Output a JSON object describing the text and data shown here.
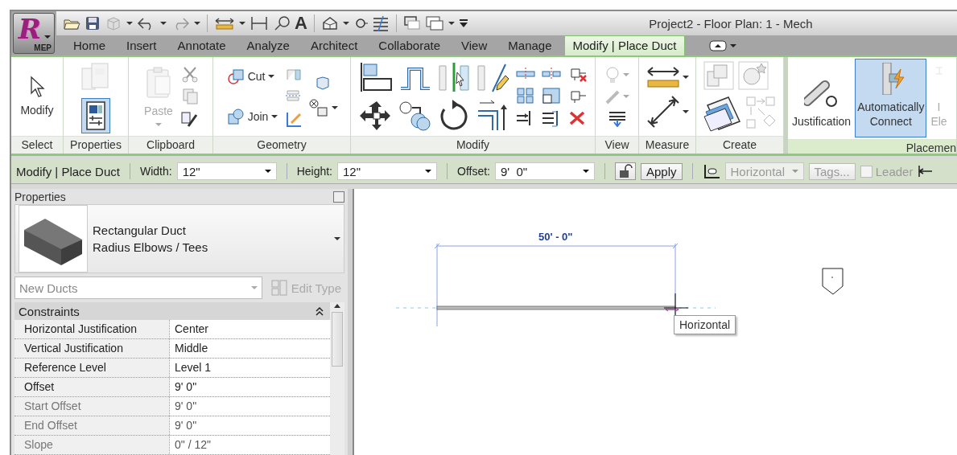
{
  "app_button": {
    "logo_letter": "R",
    "label": "MEP"
  },
  "quick_access": {
    "text_tool": "A"
  },
  "window": {
    "title": "Project2 - Floor Plan: 1 - Mech"
  },
  "tabs": [
    {
      "label": "Home",
      "selected": false
    },
    {
      "label": "Insert",
      "selected": false
    },
    {
      "label": "Annotate",
      "selected": false
    },
    {
      "label": "Analyze",
      "selected": false
    },
    {
      "label": "Architect",
      "selected": false
    },
    {
      "label": "Collaborate",
      "selected": false
    },
    {
      "label": "View",
      "selected": false
    },
    {
      "label": "Manage",
      "selected": false
    },
    {
      "label": "Modify | Place Duct",
      "selected": true
    }
  ],
  "ribbon": {
    "panels": [
      {
        "label": "Select",
        "contextual": false,
        "tools": [
          {
            "kind": "large",
            "label": "Modify",
            "selected": false,
            "disabled": false
          }
        ]
      },
      {
        "label": "Properties",
        "contextual": false,
        "tools": [
          {
            "kind": "stack",
            "selected": false,
            "disabled": true
          },
          {
            "kind": "stack",
            "selected": true,
            "disabled": false
          }
        ]
      },
      {
        "label": "Clipboard",
        "contextual": false,
        "tools": [
          {
            "kind": "large",
            "label": "Paste",
            "selected": false,
            "disabled": true
          }
        ]
      },
      {
        "label": "Geometry",
        "contextual": false,
        "tools": [
          {
            "kind": "small",
            "label": "Cut",
            "selected": false,
            "disabled": false
          },
          {
            "kind": "small",
            "label": "Join",
            "selected": false,
            "disabled": false
          }
        ]
      },
      {
        "label": "Modify",
        "contextual": false
      },
      {
        "label": "View",
        "contextual": false
      },
      {
        "label": "Measure",
        "contextual": false
      },
      {
        "label": "Create",
        "contextual": false
      },
      {
        "label": "Placemen",
        "contextual": true,
        "tools": [
          {
            "kind": "large",
            "label": "Justification",
            "selected": false,
            "disabled": false
          },
          {
            "kind": "large",
            "label": "Automatically\nConnect",
            "selected": true,
            "disabled": false
          },
          {
            "kind": "large",
            "label": "I\nEle",
            "selected": false,
            "disabled": true
          }
        ]
      }
    ]
  },
  "options_bar": {
    "context": "Modify | Place Duct",
    "fields": [
      {
        "label": "Width:",
        "value": "12\""
      },
      {
        "label": "Height:",
        "value": "12\""
      },
      {
        "label": "Offset:",
        "value": "9'  0\""
      }
    ],
    "apply": "Apply",
    "justification": {
      "value": "Horizontal",
      "disabled": true
    },
    "tags": {
      "label": "Tags...",
      "disabled": true
    },
    "leader": {
      "label": "Leader",
      "checked": false,
      "disabled": true
    }
  },
  "properties": {
    "title": "Properties",
    "type": {
      "family": "Rectangular Duct",
      "name": "Radius Elbows / Tees"
    },
    "instance_filter": {
      "value": "New Ducts"
    },
    "edit_type": {
      "label": "Edit Type",
      "disabled": true
    },
    "groups": [
      {
        "name": "Constraints",
        "expanded": true,
        "rows": [
          {
            "name": "Horizontal Justification",
            "value": "Center",
            "disabled": false
          },
          {
            "name": "Vertical Justification",
            "value": "Middle",
            "disabled": false
          },
          {
            "name": "Reference Level",
            "value": "Level 1",
            "disabled": false
          },
          {
            "name": "Offset",
            "value": "9'  0\"",
            "disabled": false
          },
          {
            "name": "Start Offset",
            "value": "9'  0\"",
            "disabled": true
          },
          {
            "name": "End Offset",
            "value": "9'  0\"",
            "disabled": true
          },
          {
            "name": "Slope",
            "value": "0\" / 12\"",
            "disabled": true
          }
        ]
      }
    ]
  },
  "canvas": {
    "dimension": "50' - 0\"",
    "tooltip": "Horizontal"
  }
}
